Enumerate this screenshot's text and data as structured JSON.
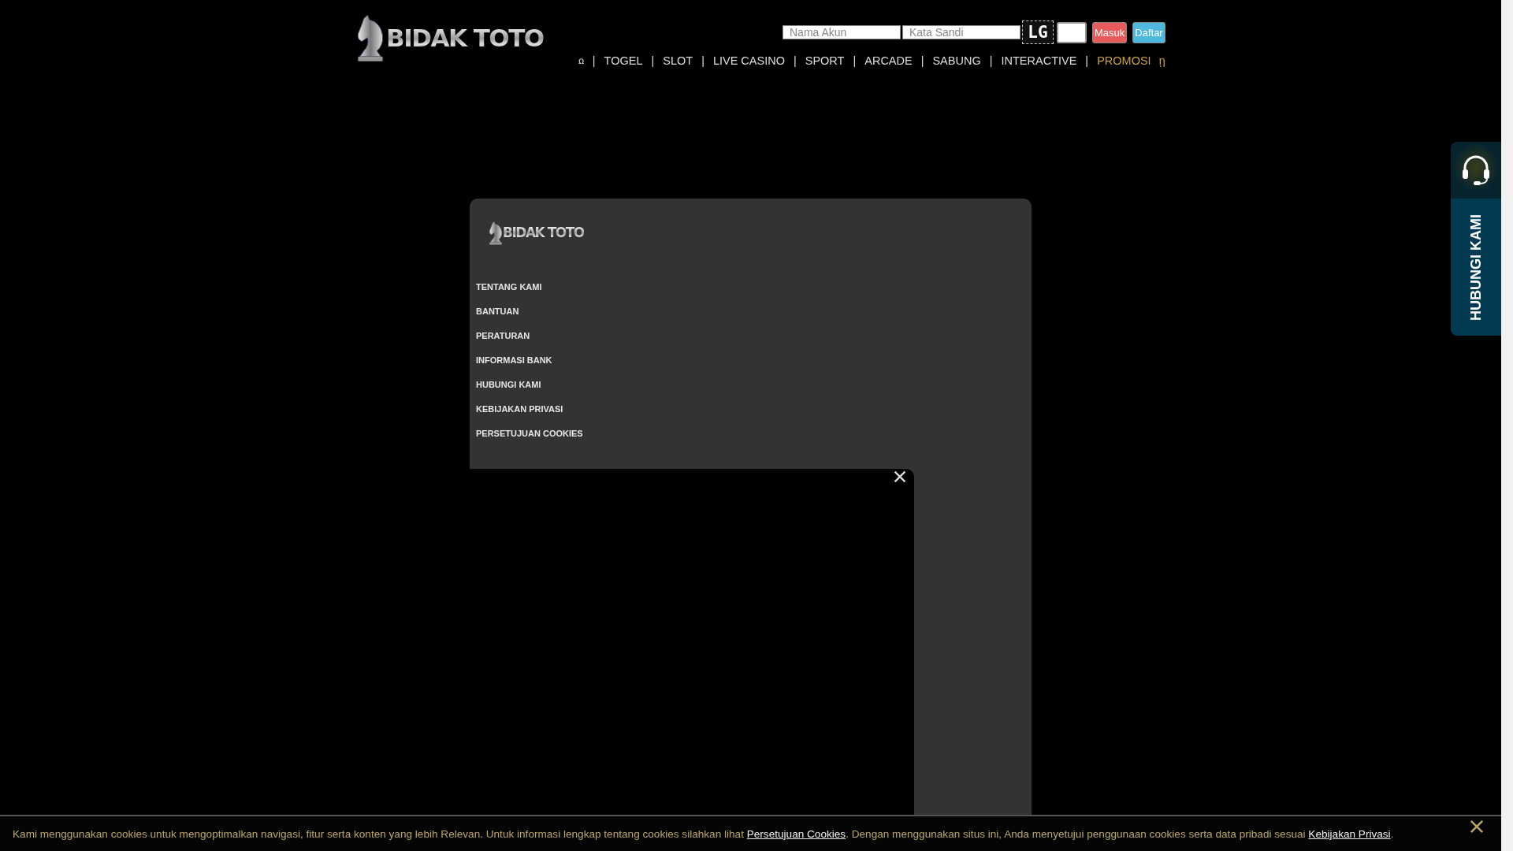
{
  "header": {
    "logo": "BIDAK TOTO",
    "login": {
      "username_placeholder": "Nama Akun",
      "password_placeholder": "Kata Sandi",
      "captcha": "LG",
      "buttons": [
        {
          "label": "Masuk",
          "kind": "login"
        },
        {
          "label": "Daftar",
          "kind": "register"
        }
      ]
    },
    "nav": {
      "separator": "|",
      "items": [
        {
          "label": "ꭥ",
          "kind": "glyph",
          "highlighted": false
        },
        {
          "label": "TOGEL",
          "kind": "link",
          "highlighted": false
        },
        {
          "label": "SLOT",
          "kind": "link",
          "highlighted": false
        },
        {
          "label": "LIVE CASINO",
          "kind": "link",
          "highlighted": false
        },
        {
          "label": "SPORT",
          "kind": "link",
          "highlighted": false
        },
        {
          "label": "ARCADE",
          "kind": "link",
          "highlighted": false
        },
        {
          "label": "SABUNG",
          "kind": "link",
          "highlighted": false
        },
        {
          "label": "INTERACTIVE",
          "kind": "link",
          "highlighted": false
        },
        {
          "label": "PROMOSI",
          "kind": "link",
          "highlighted": true
        }
      ],
      "trailing_glyph": "ῃ"
    }
  },
  "panel": {
    "logo": "BIDAK TOTO",
    "menu": [
      "TENTANG KAMI",
      "BANTUAN",
      "PERATURAN",
      "INFORMASI BANK",
      "HUBUNGI KAMI",
      "KEBIJAKAN PRIVASI",
      "PERSETUJUAN COOKIES"
    ]
  },
  "contact_widget": {
    "label": "HUBUNGI KAMI"
  },
  "cookie_bar": {
    "text_before": "Kami menggunakan cookies untuk mengoptimalkan navigasi, fitur serta konten yang lebih Relevan. Untuk informasi lengkap tentang cookies silahkan lihat",
    "link_1": "Persetujuan Cookies",
    "text_middle": ". Dengan menggunakan situs ini, Anda menyetujui penggunaan cookies serta data pribadi sesuai",
    "link_2": "Kebijakan Privasi",
    "text_after": "."
  }
}
